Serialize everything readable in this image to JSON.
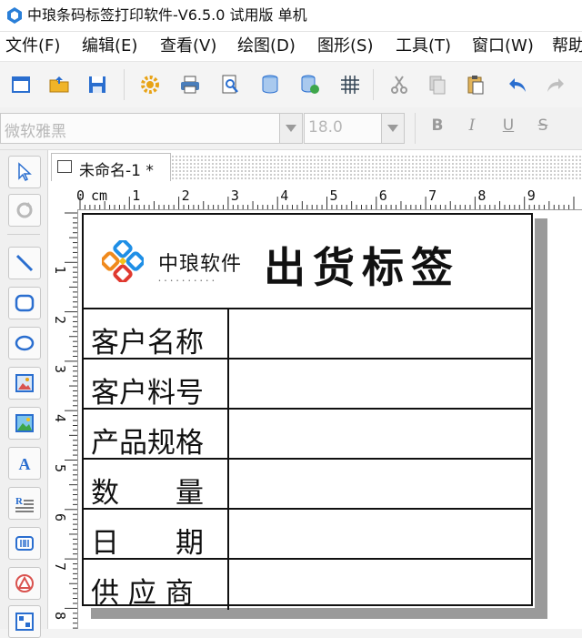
{
  "window": {
    "title": "中琅条码标签打印软件-V6.5.0 试用版 单机"
  },
  "menu": [
    {
      "label": "文件(F)"
    },
    {
      "label": "编辑(E)"
    },
    {
      "label": "查看(V)"
    },
    {
      "label": "绘图(D)"
    },
    {
      "label": "图形(S)"
    },
    {
      "label": "工具(T)"
    },
    {
      "label": "窗口(W)"
    },
    {
      "label": "帮助"
    }
  ],
  "toolbar": {
    "icons": [
      "new-icon",
      "open-icon",
      "save-icon",
      "settings-gear-icon",
      "print-icon",
      "print-preview-icon",
      "database-icon",
      "database-settings-icon",
      "grid-icon",
      "cut-icon",
      "copy-icon",
      "paste-icon",
      "undo-icon",
      "redo-icon"
    ]
  },
  "fontbar": {
    "font_name": "微软雅黑",
    "font_size": "18.0",
    "bold": "B",
    "italic": "I",
    "underline": "U",
    "strike": "S"
  },
  "tab": {
    "label": "未命名-1 *"
  },
  "ruler": {
    "unit": "cm",
    "top_ticks": [
      "0",
      "1",
      "2",
      "3",
      "4",
      "5",
      "6",
      "7",
      "8",
      "9"
    ],
    "left_ticks": [
      "1",
      "2",
      "3",
      "4",
      "5",
      "6",
      "7",
      "8"
    ]
  },
  "label": {
    "logo_name": "中琅软件",
    "logo_sub": "• • • • • • • • • •",
    "title": "出货标签",
    "rows": [
      {
        "label": "客户名称",
        "value": ""
      },
      {
        "label": "客户料号",
        "value": ""
      },
      {
        "label": "产品规格",
        "value": ""
      },
      {
        "label": "数　　量",
        "value": ""
      },
      {
        "label": "日　　期",
        "value": ""
      },
      {
        "label": "供 应 商",
        "value": ""
      }
    ]
  },
  "colors": {
    "accent_blue": "#2a6ecf",
    "logo_blue": "#1f8fe6",
    "logo_orange": "#f08a1d",
    "logo_red": "#e0392f",
    "logo_yellow": "#f5c21a"
  }
}
